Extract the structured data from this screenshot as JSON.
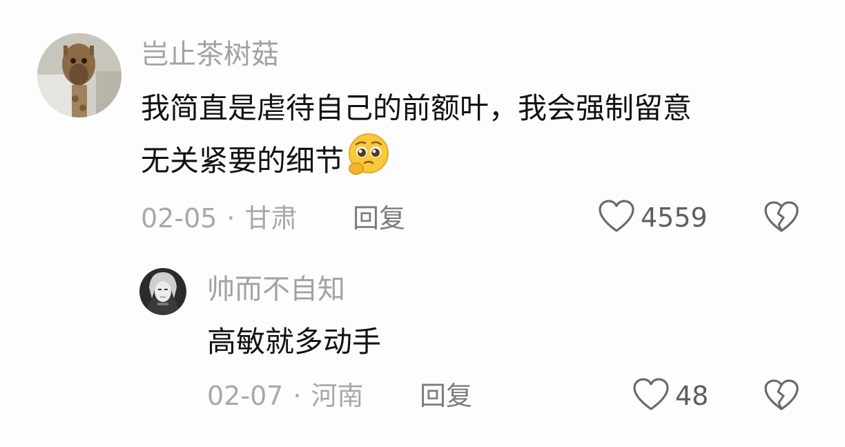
{
  "comments": [
    {
      "username": "岂止茶树菇",
      "avatar": "giraffe-photo",
      "text_line1": "我简直是虐待自己的前额叶，我会强制留意",
      "text_line2": "无关紧要的细节",
      "emoji": "pleading-face-emoji",
      "date": "02-05",
      "separator": "·",
      "location": "甘肃",
      "reply_label": "回复",
      "likes": "4559",
      "like_icon": "heart-outline-icon",
      "dislike_icon": "broken-heart-icon"
    },
    {
      "username": "帅而不自知",
      "avatar": "anime-character",
      "text": "高敏就多动手",
      "date": "02-07",
      "separator": "·",
      "location": "河南",
      "reply_label": "回复",
      "likes": "48",
      "like_icon": "heart-outline-icon",
      "dislike_icon": "broken-heart-icon"
    }
  ]
}
